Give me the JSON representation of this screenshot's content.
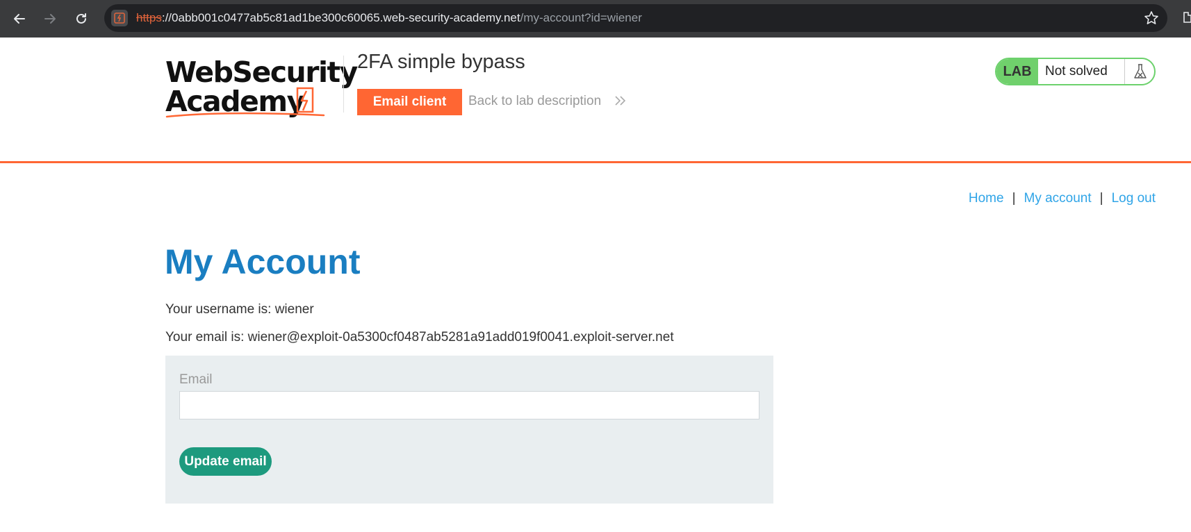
{
  "browser": {
    "url_scheme": "https",
    "url_host": "://0abb001c0477ab5c81ad1be300c60065.web-security-academy.net",
    "url_path": "/my-account?id=wiener"
  },
  "header": {
    "logo_line1": "WebSecurity",
    "logo_line2": "Academy",
    "lab_title": "2FA simple bypass",
    "email_client_label": "Email client",
    "back_link_label": "Back to lab description"
  },
  "lab_status": {
    "tag": "LAB",
    "status": "Not solved"
  },
  "nav": {
    "home": "Home",
    "separator": "|",
    "my_account": "My account",
    "log_out": "Log out"
  },
  "account": {
    "title": "My Account",
    "username_line": "Your username is: wiener",
    "email_line": "Your email is: wiener@exploit-0a5300cf0487ab5281a91add019f0041.exploit-server.net",
    "email_field_label": "Email",
    "email_field_value": "",
    "update_button_label": "Update email"
  },
  "colors": {
    "accent_orange": "#ff6633",
    "link_blue": "#2fa4e7",
    "title_blue": "#1a7ec1",
    "button_green": "#1d9a7e",
    "lab_green": "#70d06c"
  }
}
